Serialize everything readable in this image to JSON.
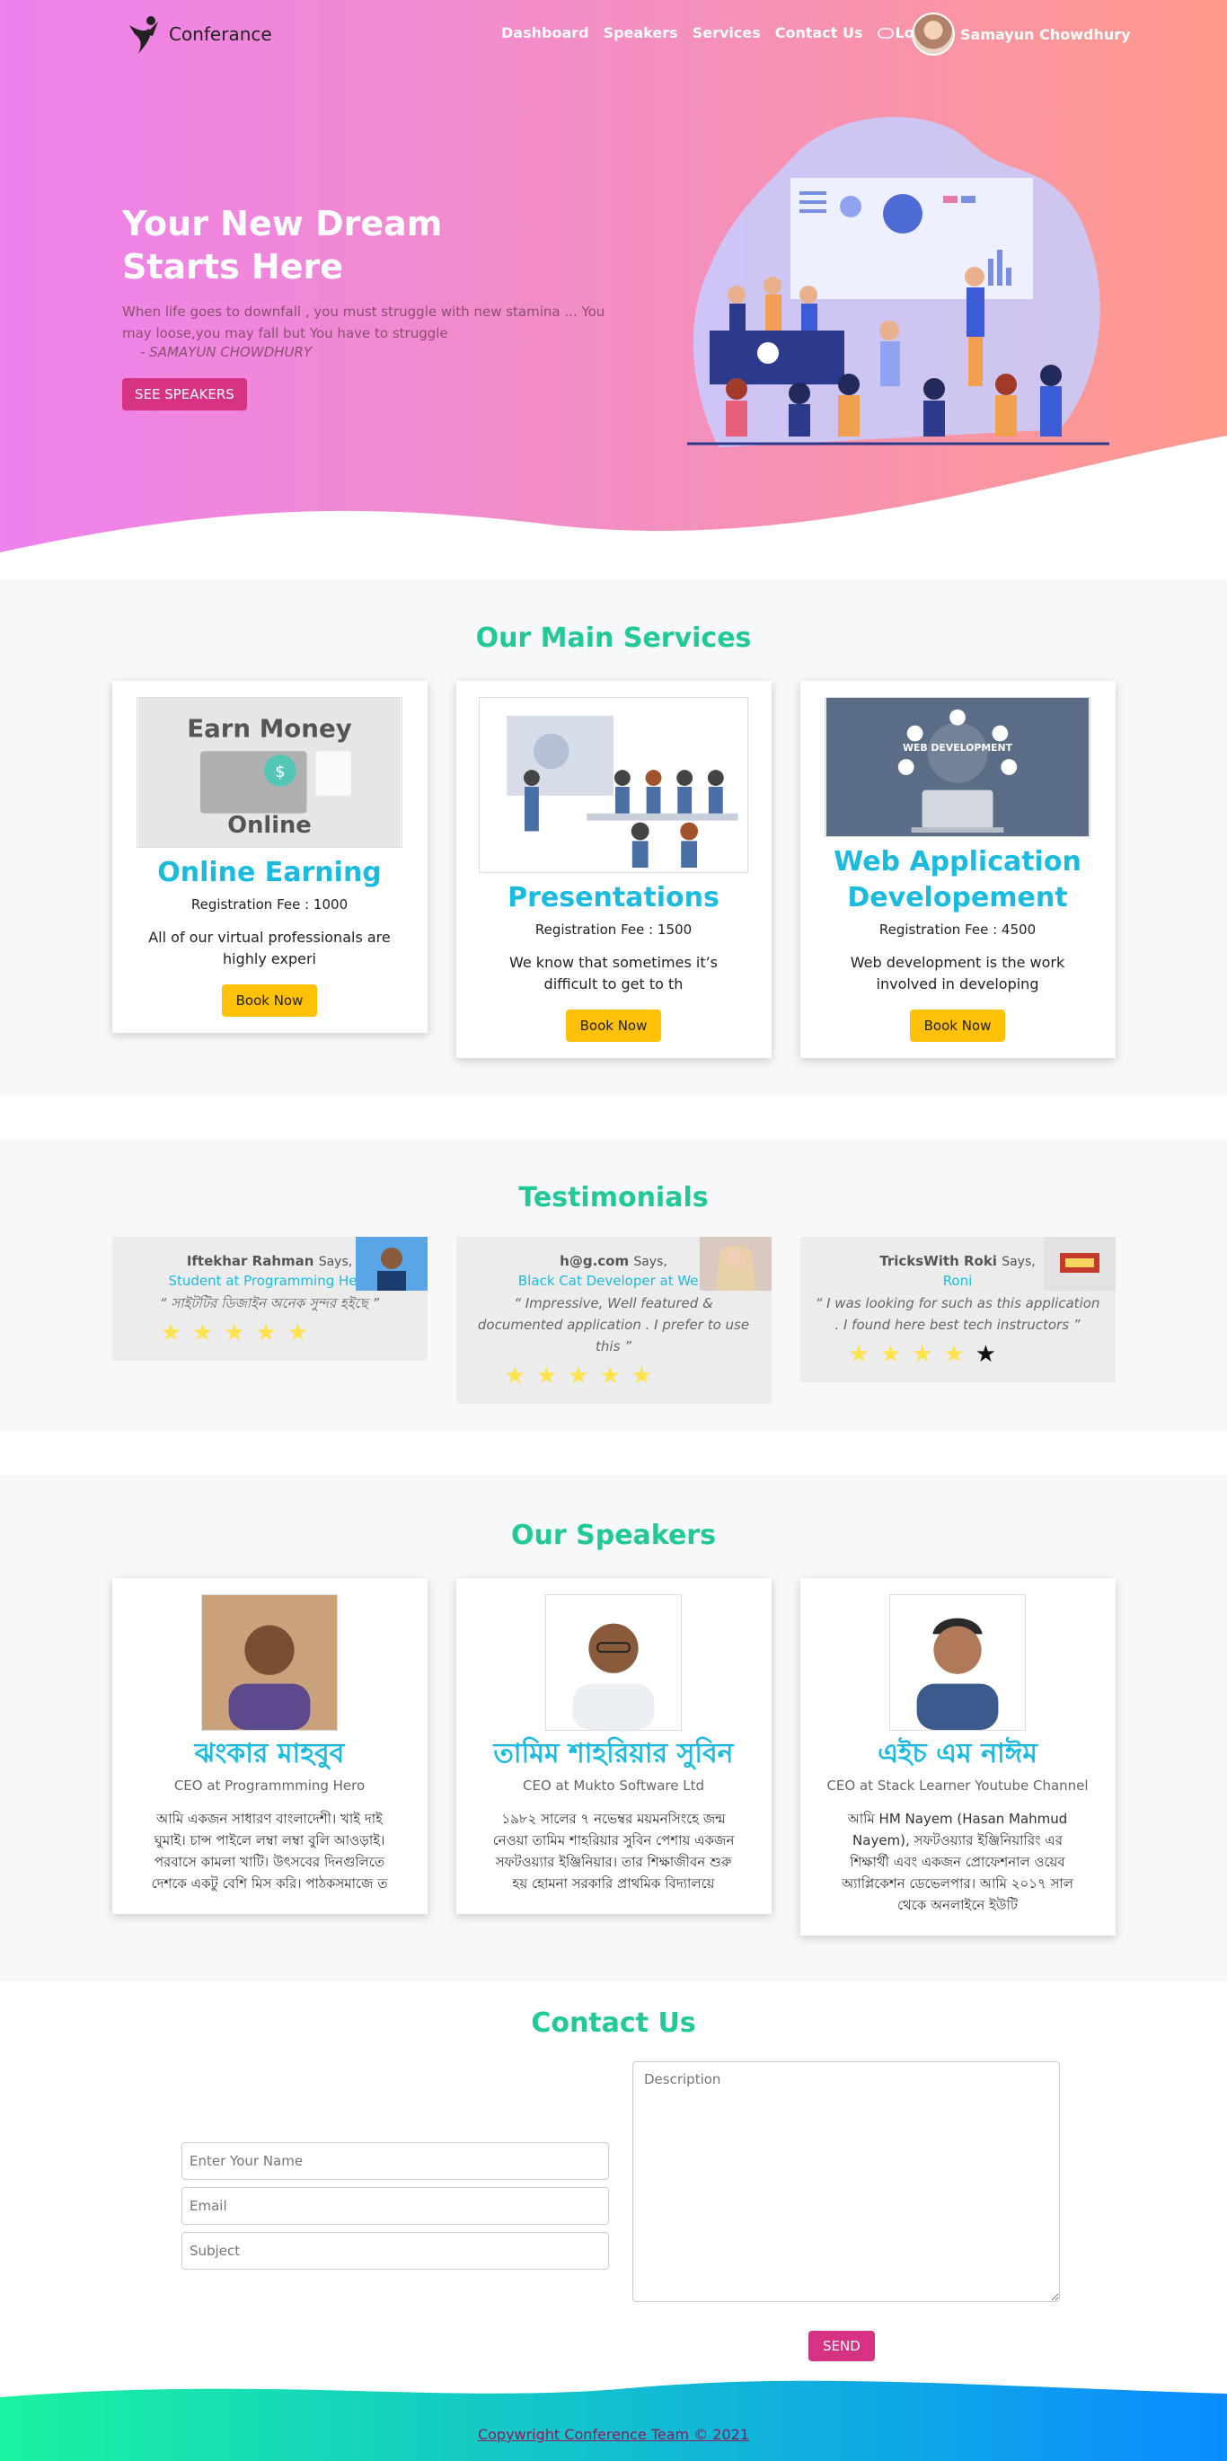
{
  "nav": {
    "brand": "Conferance",
    "links": [
      "Dashboard",
      "Speakers",
      "Services",
      "Contact Us",
      "Logout"
    ],
    "user_name": "Samayun Chowdhury"
  },
  "hero": {
    "title_line1": "Your New Dream",
    "title_line2": "Starts Here",
    "quote": "When life goes to downfall , you must struggle with new stamina ... You may loose,you may fall but You have to struggle",
    "author": "- SAMAYUN CHOWDHURY",
    "button": "SEE SPEAKERS"
  },
  "services": {
    "title": "Our Main Services",
    "items": [
      {
        "image_title": "Earn Money",
        "image_subtitle": "Online",
        "name": "Online Earning",
        "fee": "Registration Fee : 1000",
        "desc": "All of our virtual professionals are highly experi",
        "button": "Book Now"
      },
      {
        "name": "Presentations",
        "fee": "Registration Fee : 1500",
        "desc": "We know that sometimes it’s difficult to get to th",
        "button": "Book Now"
      },
      {
        "image_title": "WEB DEVELOPMENT",
        "name": "Web Application Developement",
        "fee": "Registration Fee : 4500",
        "desc": "Web development is the work involved in developing",
        "button": "Book Now"
      }
    ]
  },
  "testimonials": {
    "title": "Testimonials",
    "items": [
      {
        "name": "Iftekhar Rahman",
        "says": "Says,",
        "role": "Student at Programming Hero",
        "quote": "“ সাইটটির ডিজাইন অনেক সুন্দর হইছে ”",
        "rating": 5
      },
      {
        "name": "h@g.com",
        "says": "Says,",
        "role": "Black Cat Developer at WeD",
        "quote": "“ Impressive, Well featured & documented application . I prefer to use this ”",
        "rating": 5
      },
      {
        "name": "TricksWith Roki",
        "says": "Says,",
        "role": "Roni",
        "quote": "“ I was looking for such as this application . I found here best tech instructors ”",
        "rating": 4
      }
    ]
  },
  "speakers": {
    "title": "Our Speakers",
    "items": [
      {
        "name": "ঝংকার মাহবুব",
        "role": "CEO at Programmming Hero",
        "bio": "আমি একজন সাধারণ বাংলাদেশী। খাই দাই ঘুমাই। চান্স পাইলে লম্বা লম্বা বুলি আওড়াই। পরবাসে কামলা খাটি। উৎসবের দিনগুলিতে দেশকে একটু বেশি মিস করি। পাঠকসমাজে ত"
      },
      {
        "name": "তামিম শাহরিয়ার সুবিন",
        "role": "CEO at Mukto Software Ltd",
        "bio": "১৯৮২ সালের ৭ নভেম্বর ময়মনসিংহে জন্ম নেওয়া তামিম শাহরিয়ার সুবিন পেশায় একজন সফটওয়্যার ইঞ্জিনিয়ার। তার শিক্ষাজীবন শুরু হয় হোমনা সরকারি প্রাথমিক বিদ্যালয়ে"
      },
      {
        "name": "এইচ এম নাঈম",
        "role": "CEO at Stack Learner Youtube Channel",
        "bio": "আমি HM Nayem (Hasan Mahmud Nayem), সফটওয়্যার ইঞ্জিনিয়ারিং এর শিক্ষার্থী এবং একজন প্রোফেশনাল ওয়েব অ্যাপ্লিকেশন ডেভেলপার। আমি ২০১৭ সাল থেকে অনলাইনে ইউটি"
      }
    ]
  },
  "contact": {
    "title": "Contact Us",
    "name_placeholder": "Enter Your Name",
    "email_placeholder": "Email",
    "subject_placeholder": "Subject",
    "description_placeholder": "Description",
    "send": "SEND"
  },
  "footer": {
    "text": "Copywright Conference Team © 2021"
  },
  "colors": {
    "accent_green": "#20c997",
    "accent_cyan": "#1bbbe0",
    "pink_button": "#d63384",
    "yellow_button": "#ffc107"
  }
}
